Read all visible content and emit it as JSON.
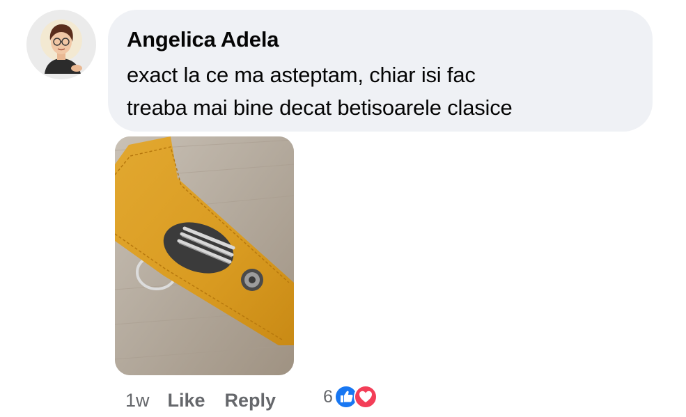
{
  "comment": {
    "author": "Angelica Adela",
    "text_line1": "exact la ce ma asteptam, chiar isi fac",
    "text_line2": "treaba mai bine decat betisoarele clasice",
    "time": "1w",
    "like_label": "Like",
    "reply_label": "Reply",
    "reaction_count": "6",
    "reaction_icons": [
      "like-icon",
      "love-icon"
    ],
    "attachment_icon": "photo-keychain-earwax-tools"
  },
  "colors": {
    "bubble_bg": "#eff1f5",
    "secondary_text": "#65676b",
    "like_blue": "#1877f2",
    "love_red": "#f33e58"
  }
}
